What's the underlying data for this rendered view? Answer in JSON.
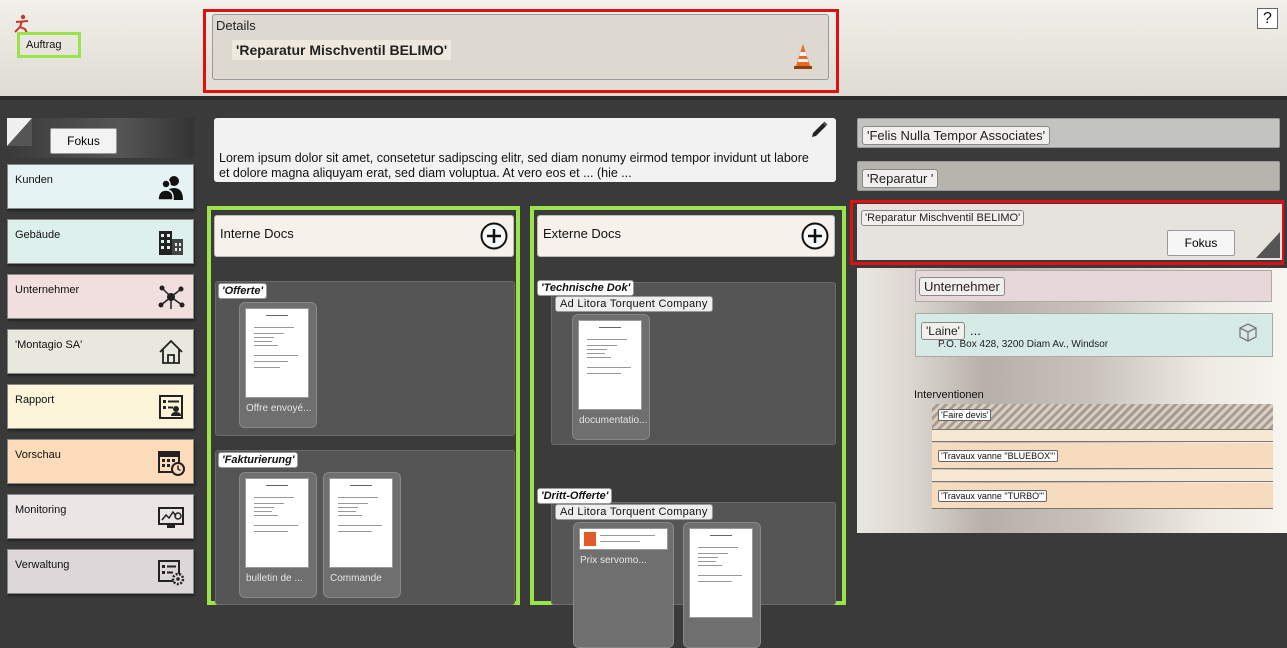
{
  "header": {
    "auftrag_tab": "Auftrag",
    "details_label": "Details",
    "details_value": "'Reparatur Mischventil BELIMO'",
    "help_label": "?"
  },
  "sidebar": {
    "fokus_label": "Fokus",
    "items": [
      {
        "label": "Kunden",
        "color": "#e6f3f4",
        "icon": "people-icon"
      },
      {
        "label": "Gebäude",
        "color": "#def0ec",
        "icon": "buildings-icon"
      },
      {
        "label": "Unternehmer",
        "color": "#f1dede",
        "icon": "network-icon"
      },
      {
        "label": "'Montagio SA'",
        "color": "#e9e8de",
        "icon": "house-icon"
      },
      {
        "label": "Rapport",
        "color": "#fdf5da",
        "icon": "report-icon"
      },
      {
        "label": "Vorschau",
        "color": "#fddcbc",
        "icon": "calendar-clock-icon"
      },
      {
        "label": "Monitoring",
        "color": "#ece5e5",
        "icon": "monitor-icon"
      },
      {
        "label": "Verwaltung",
        "color": "#ded7da",
        "icon": "admin-settings-icon"
      }
    ]
  },
  "description": {
    "text": "Lorem ipsum dolor sit amet, consetetur sadipscing elitr, sed diam nonumy eirmod tempor invidunt ut labore et dolore magna aliquyam erat, sed diam voluptua. At vero eos et ... (hie ..."
  },
  "interne_docs": {
    "title": "Interne Docs",
    "groups": [
      {
        "label": "'Offerte'",
        "files": [
          "Offre envoyé..."
        ]
      },
      {
        "label": "'Fakturierung'",
        "files": [
          "bulletin de ...",
          "Commande"
        ]
      }
    ]
  },
  "externe_docs": {
    "title": "Externe Docs",
    "groups": [
      {
        "label": "'Technische Dok'",
        "company": "Ad Litora Torquent Company",
        "files": [
          "documentatio..."
        ]
      },
      {
        "label": "'Dritt-Offerte'",
        "company": "Ad Litora Torquent Company",
        "files": [
          "Prix servomo...",
          ""
        ]
      }
    ]
  },
  "right_panel": {
    "client": "'Felis Nulla Tempor Associates'",
    "category": "'Reparatur '",
    "focus_item": "'Reparatur Mischventil BELIMO'",
    "fokus_button": "Fokus",
    "unternehmer": "Unternehmer",
    "laine_label": "'Laine'",
    "laine_more": "...",
    "laine_address": "P.O. Box 428, 3200 Diam Av., Windsor",
    "interventionen_label": "Interventionen",
    "interventionen": [
      {
        "label": "'Faire devis'",
        "style": "hatched"
      },
      {
        "label": "",
        "style": "plain"
      },
      {
        "label": "'Travaux vanne \"BLUEBOX\"'",
        "style": "plain"
      },
      {
        "label": "'Travaux vanne \"TURBO\"'",
        "style": "plain"
      }
    ]
  },
  "colors": {
    "highlight_red": "#e01010",
    "highlight_green": "#9be34a",
    "intervention_bg": "#f6dcbc"
  }
}
